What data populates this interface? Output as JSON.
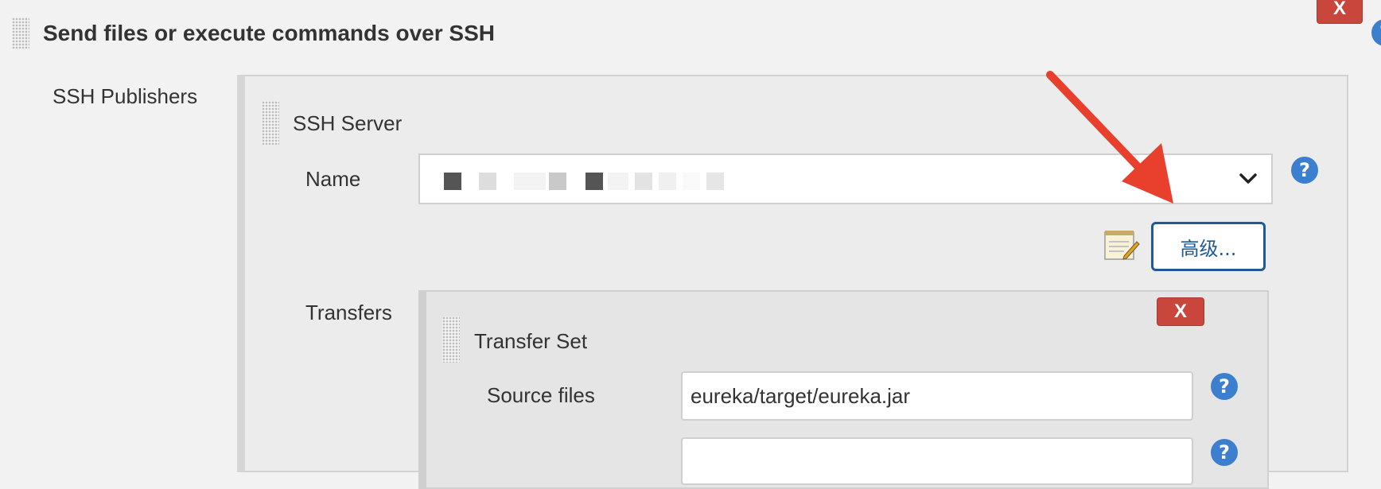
{
  "section": {
    "title": "Send files or execute commands over SSH",
    "delete_label": "X"
  },
  "publishers": {
    "label": "SSH Publishers"
  },
  "ssh_server": {
    "title": "SSH Server",
    "name_label": "Name",
    "name_value": "",
    "advanced_button": "高级...",
    "help": "?"
  },
  "transfers": {
    "label": "Transfers"
  },
  "transfer_set": {
    "title": "Transfer Set",
    "delete_label": "X",
    "source_files_label": "Source files",
    "source_files_value": "eureka/target/eureka.jar",
    "remove_prefix_value": "",
    "help": "?"
  },
  "colors": {
    "delete_red": "#c9463d",
    "help_blue": "#3d7fcf",
    "button_blue": "#1f5a96",
    "annotation_arrow": "#e8402d"
  },
  "icons": {
    "grip": "drag-handle-icon",
    "help": "help-icon",
    "notepad": "notepad-icon",
    "dropdown": "chevron-down-icon"
  }
}
